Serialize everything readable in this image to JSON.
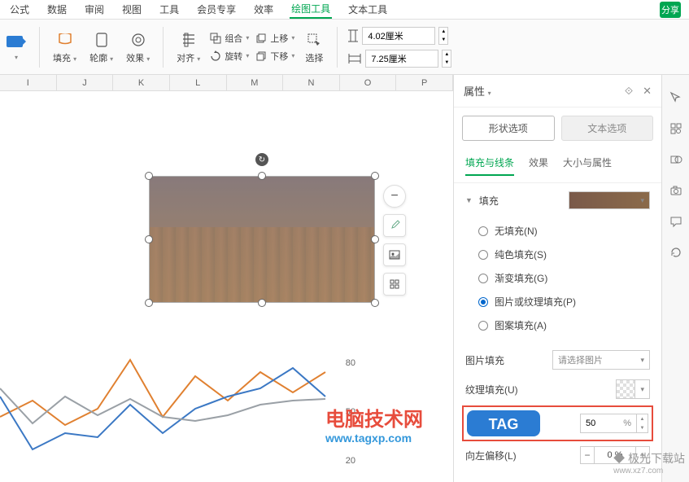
{
  "top_tabs": {
    "items": [
      "公式",
      "数据",
      "审阅",
      "视图",
      "工具",
      "会员专享",
      "效率",
      "绘图工具",
      "文本工具"
    ],
    "active_index": 7,
    "share": "分享"
  },
  "ribbon": {
    "fill": "填充",
    "outline": "轮廓",
    "effects": "效果",
    "align": "对齐",
    "group": "组合",
    "rotate": "旋转",
    "move_up": "上移",
    "move_down": "下移",
    "select": "选择",
    "height": "4.02厘米",
    "width": "7.25厘米"
  },
  "columns": [
    "I",
    "J",
    "K",
    "L",
    "M",
    "N",
    "O",
    "P"
  ],
  "float_tools": {
    "zoom_out": "−",
    "eyedropper": "eyedropper",
    "pic": "pic",
    "grid": "grid"
  },
  "chart_data": {
    "type": "line",
    "y_ticks": [
      20,
      50,
      80
    ],
    "series": [
      {
        "name": "orange",
        "color": "#e08030",
        "values": [
          40,
          50,
          35,
          45,
          80,
          40,
          70,
          50,
          72,
          58,
          72
        ]
      },
      {
        "name": "blue",
        "color": "#3b78c4",
        "values": [
          55,
          22,
          30,
          28,
          48,
          30,
          45,
          55,
          60,
          75,
          55
        ]
      },
      {
        "name": "gray",
        "color": "#9aa0a6",
        "values": [
          60,
          38,
          55,
          42,
          52,
          40,
          38,
          42,
          48,
          50,
          52
        ]
      }
    ]
  },
  "props": {
    "title": "属性",
    "shape_option": "形状选项",
    "text_option": "文本选项",
    "sub_tabs": [
      "填充与线条",
      "效果",
      "大小与属性"
    ],
    "sub_active": 0,
    "fill_label": "填充",
    "fill_options": {
      "none": "无填充(N)",
      "solid": "纯色填充(S)",
      "gradient": "渐变填充(G)",
      "picture": "图片或纹理填充(P)",
      "pattern": "图案填充(A)"
    },
    "pic_fill_label": "图片填充",
    "pic_fill_placeholder": "请选择图片",
    "texture_label": "纹理填充(U)",
    "transparency_value": "50",
    "transparency_unit": "%",
    "offset_left_label": "向左偏移(L)",
    "offset_left_value": "0",
    "offset_left_unit": "%"
  },
  "watermarks": {
    "site1": "电脑技术网",
    "url1": "www.tagxp.com",
    "tag": "TAG",
    "site2": "极光下载站",
    "url2": "www.xz7.com"
  }
}
